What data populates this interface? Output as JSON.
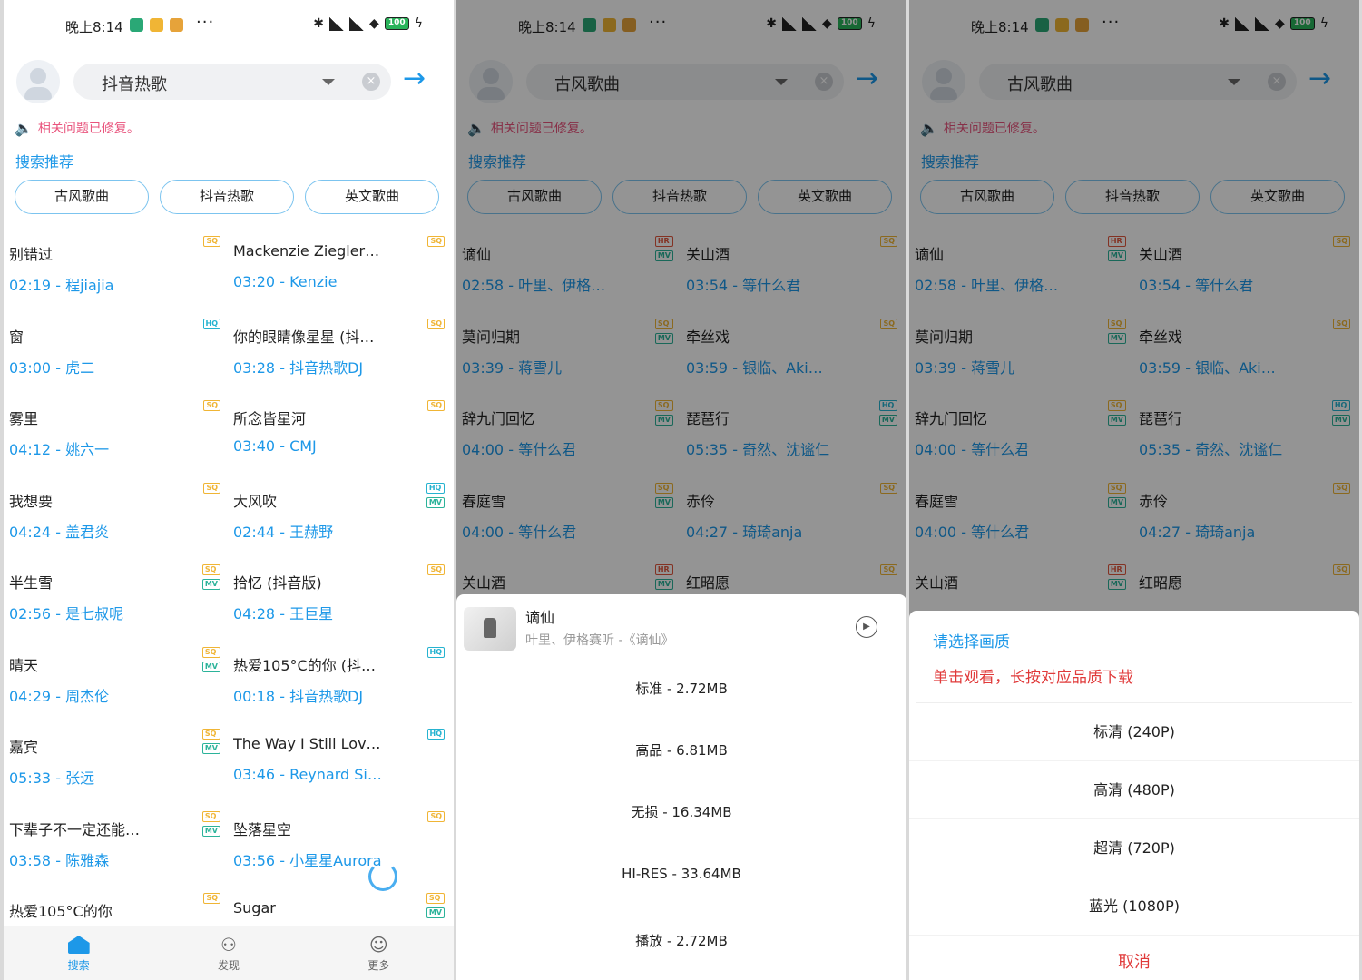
{
  "status": {
    "time": "晚上8:14",
    "battery": "100"
  },
  "panels": [
    {
      "query": "抖音热歌",
      "notice": "相关问题已修复。",
      "recommend": "搜索推荐",
      "tags": [
        "古风歌曲",
        "抖音热歌",
        "英文歌曲"
      ],
      "songs": [
        {
          "title": "别错过",
          "time": "02:19",
          "artist": "程jiajia",
          "badges": [
            "SQ"
          ]
        },
        {
          "title": "Mackenzie Ziegler…",
          "time": "03:20",
          "artist": "Kenzie",
          "badges": [
            "SQ"
          ]
        },
        {
          "title": "窗",
          "time": "03:00",
          "artist": "虎二",
          "badges": [
            "HQ"
          ]
        },
        {
          "title": "你的眼睛像星星 (抖…",
          "time": "03:28",
          "artist": "抖音热歌DJ",
          "badges": [
            "SQ"
          ]
        },
        {
          "title": "雾里",
          "time": "04:12",
          "artist": "姚六一",
          "badges": [
            "SQ"
          ]
        },
        {
          "title": "所念皆星河",
          "time": "03:40",
          "artist": "CMJ",
          "badges": [
            "SQ"
          ]
        },
        {
          "title": "我想要",
          "time": "04:24",
          "artist": "盖君炎",
          "badges": [
            "SQ"
          ]
        },
        {
          "title": "大风吹",
          "time": "02:44",
          "artist": "王赫野",
          "badges": [
            "HQ",
            "MV"
          ]
        },
        {
          "title": "半生雪",
          "time": "02:56",
          "artist": "是七叔呢",
          "badges": [
            "SQ",
            "MV"
          ]
        },
        {
          "title": "拾忆 (抖音版)",
          "time": "04:28",
          "artist": "王巨星",
          "badges": [
            "SQ"
          ]
        },
        {
          "title": "晴天",
          "time": "04:29",
          "artist": "周杰伦",
          "badges": [
            "SQ",
            "MV"
          ]
        },
        {
          "title": "热爱105°C的你 (抖…",
          "time": "00:18",
          "artist": "抖音热歌DJ",
          "badges": [
            "HQ"
          ]
        },
        {
          "title": "嘉宾",
          "time": "05:33",
          "artist": "张远",
          "badges": [
            "SQ",
            "MV"
          ]
        },
        {
          "title": "The Way I Still Lov…",
          "time": "03:46",
          "artist": "Reynard Si…",
          "badges": [
            "HQ"
          ]
        },
        {
          "title": "下辈子不一定还能…",
          "time": "03:58",
          "artist": "陈雅森",
          "badges": [
            "SQ",
            "MV"
          ]
        },
        {
          "title": "坠落星空",
          "time": "03:56",
          "artist": "小星星Aurora",
          "badges": [
            "SQ"
          ]
        },
        {
          "title": "热爱105°C的你",
          "time": "",
          "artist": "",
          "badges": [
            "SQ"
          ]
        },
        {
          "title": "Sugar",
          "time": "",
          "artist": "",
          "badges": [
            "SQ",
            "MV"
          ]
        }
      ],
      "nav": [
        "搜索",
        "发现",
        "更多"
      ]
    },
    {
      "query": "古风歌曲",
      "notice": "相关问题已修复。",
      "recommend": "搜索推荐",
      "tags": [
        "古风歌曲",
        "抖音热歌",
        "英文歌曲"
      ],
      "songs": [
        {
          "title": "谪仙",
          "time": "02:58",
          "artist": "叶里、伊格…",
          "badges": [
            "HR",
            "MV"
          ]
        },
        {
          "title": "关山酒",
          "time": "03:54",
          "artist": "等什么君",
          "badges": [
            "SQ"
          ]
        },
        {
          "title": "莫问归期",
          "time": "03:39",
          "artist": "蒋雪儿",
          "badges": [
            "SQ",
            "MV"
          ]
        },
        {
          "title": "牵丝戏",
          "time": "03:59",
          "artist": "银临、Aki…",
          "badges": [
            "SQ"
          ]
        },
        {
          "title": "辞九门回忆",
          "time": "04:00",
          "artist": "等什么君",
          "badges": [
            "SQ",
            "MV"
          ]
        },
        {
          "title": "琵琶行",
          "time": "05:35",
          "artist": "奇然、沈谧仁",
          "badges": [
            "HQ",
            "MV"
          ]
        },
        {
          "title": "春庭雪",
          "time": "04:00",
          "artist": "等什么君",
          "badges": [
            "SQ",
            "MV"
          ]
        },
        {
          "title": "赤伶",
          "time": "04:27",
          "artist": "琦琦anja",
          "badges": [
            "SQ"
          ]
        },
        {
          "title": "关山酒",
          "time": "",
          "artist": "",
          "badges": [
            "HR",
            "MV"
          ]
        },
        {
          "title": "红昭愿",
          "time": "",
          "artist": "",
          "badges": [
            "SQ"
          ]
        }
      ],
      "sheet": {
        "title": "谪仙",
        "sub": "叶里、伊格赛听 -《谪仙》",
        "options": [
          "标准 - 2.72MB",
          "高品 - 6.81MB",
          "无损 - 16.34MB",
          "HI-RES - 33.64MB",
          "播放 - 2.72MB"
        ]
      }
    },
    {
      "query": "古风歌曲",
      "notice": "相关问题已修复。",
      "recommend": "搜索推荐",
      "tags": [
        "古风歌曲",
        "抖音热歌",
        "英文歌曲"
      ],
      "songs": [
        {
          "title": "谪仙",
          "time": "02:58",
          "artist": "叶里、伊格…",
          "badges": [
            "HR",
            "MV"
          ]
        },
        {
          "title": "关山酒",
          "time": "03:54",
          "artist": "等什么君",
          "badges": [
            "SQ"
          ]
        },
        {
          "title": "莫问归期",
          "time": "03:39",
          "artist": "蒋雪儿",
          "badges": [
            "SQ",
            "MV"
          ]
        },
        {
          "title": "牵丝戏",
          "time": "03:59",
          "artist": "银临、Aki…",
          "badges": [
            "SQ"
          ]
        },
        {
          "title": "辞九门回忆",
          "time": "04:00",
          "artist": "等什么君",
          "badges": [
            "SQ",
            "MV"
          ]
        },
        {
          "title": "琵琶行",
          "time": "05:35",
          "artist": "奇然、沈谧仁",
          "badges": [
            "HQ",
            "MV"
          ]
        },
        {
          "title": "春庭雪",
          "time": "04:00",
          "artist": "等什么君",
          "badges": [
            "SQ",
            "MV"
          ]
        },
        {
          "title": "赤伶",
          "time": "04:27",
          "artist": "琦琦anja",
          "badges": [
            "SQ"
          ]
        },
        {
          "title": "关山酒",
          "time": "",
          "artist": "",
          "badges": [
            "HR",
            "MV"
          ]
        },
        {
          "title": "红昭愿",
          "time": "",
          "artist": "",
          "badges": [
            "SQ"
          ]
        }
      ],
      "quality": {
        "title": "请选择画质",
        "hint": "单击观看，长按对应品质下载",
        "options": [
          "标清 (240P)",
          "高清 (480P)",
          "超清 (720P)",
          "蓝光 (1080P)"
        ],
        "cancel": "取消"
      }
    }
  ],
  "colors": {
    "accent": "#1d98e8",
    "danger": "#e03a3a",
    "notice": "#e9547d"
  }
}
